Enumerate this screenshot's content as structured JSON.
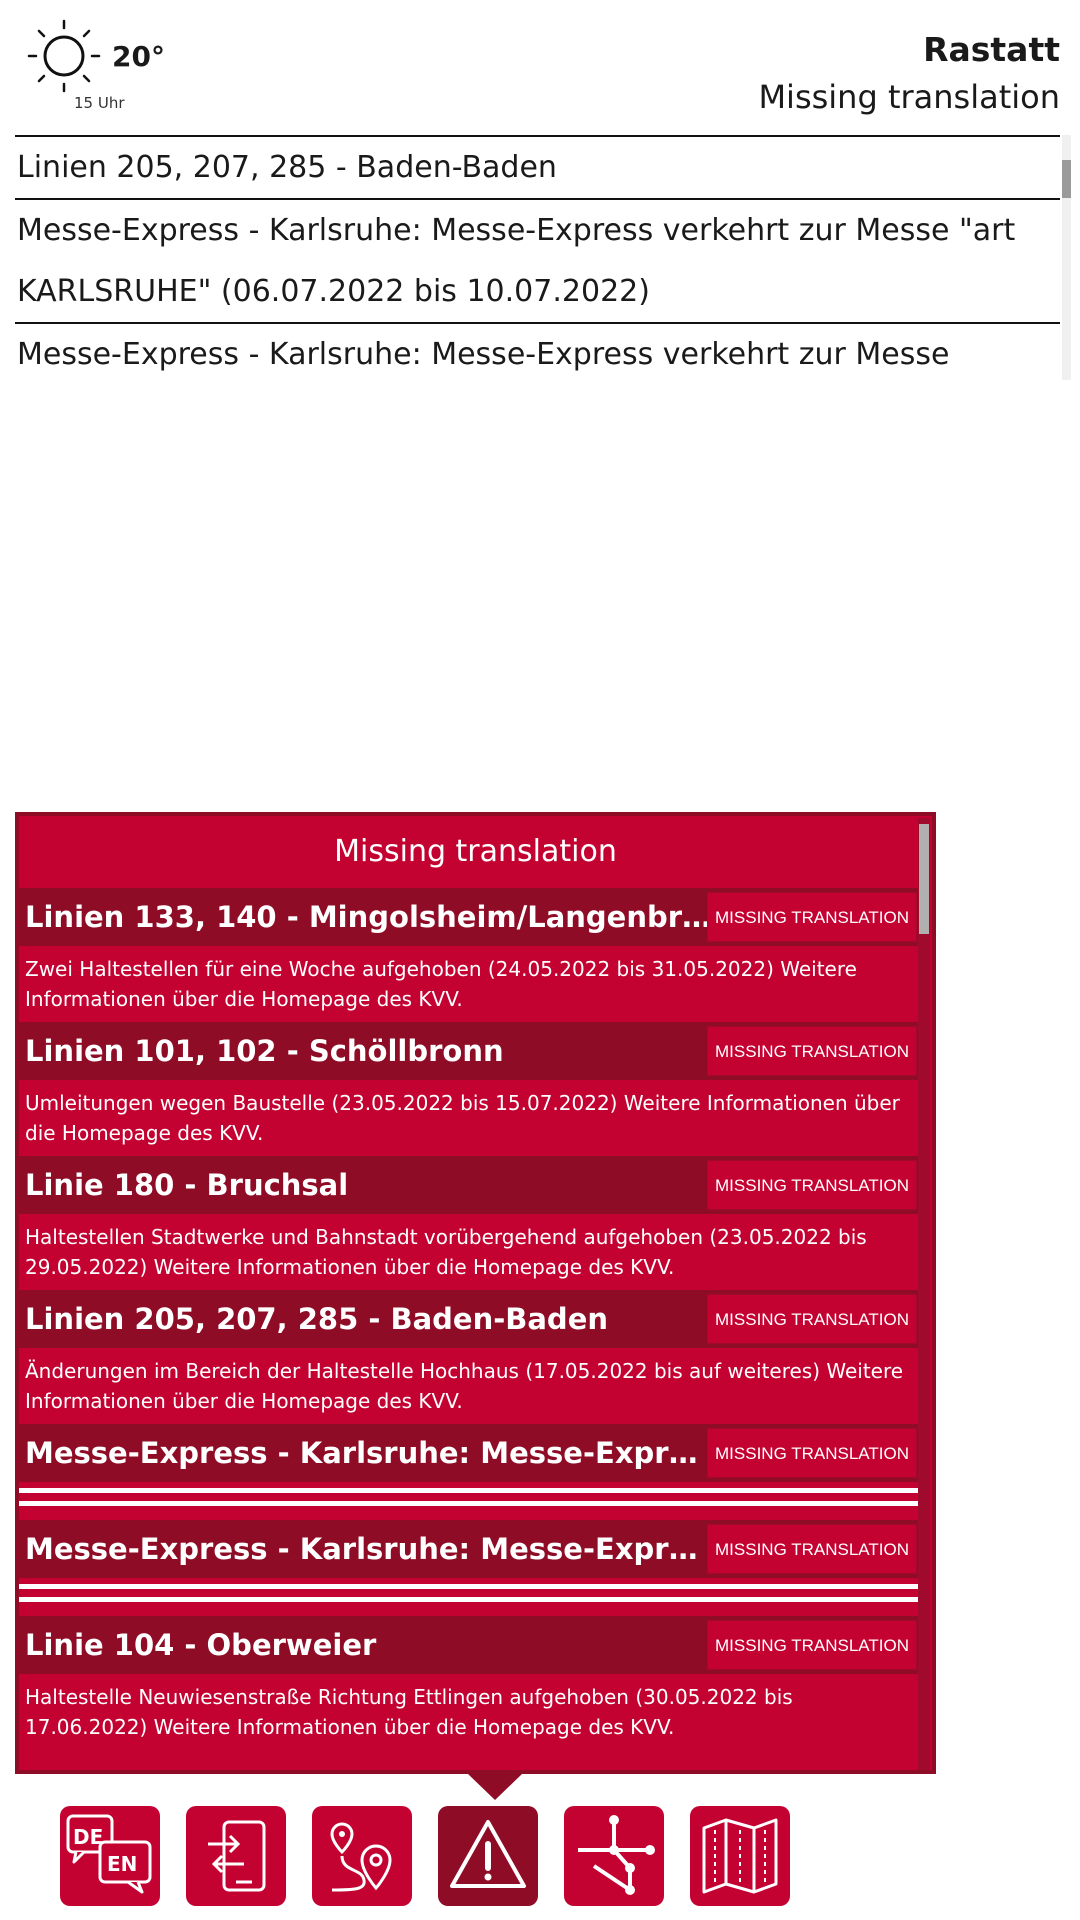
{
  "header": {
    "temperature": "20°",
    "hour": "15 Uhr",
    "city": "Rastatt",
    "subtitle": "Missing translation",
    "weather_icon": "sun-icon"
  },
  "ticker": {
    "rows": [
      "Linien 205, 207, 285 - Baden-Baden",
      "Messe-Express - Karlsruhe: Messe-Express verkehrt zur Messe \"art",
      "KARLSRUHE\" (06.07.2022 bis 10.07.2022)",
      "Messe-Express - Karlsruhe: Messe-Express verkehrt zur Messe"
    ]
  },
  "panel": {
    "title": "Missing translation",
    "alerts": [
      {
        "title": "Linien 133, 140 - Mingolsheim/Langenbrücken",
        "button": "MISSING TRANSLATION",
        "body": "Zwei Haltestellen für eine Woche aufgehoben (24.05.2022 bis 31.05.2022) Weitere Informationen über die Homepage des KVV."
      },
      {
        "title": "Linien 101, 102 - Schöllbronn",
        "button": "MISSING TRANSLATION",
        "body": "Umleitungen wegen Baustelle (23.05.2022 bis 15.07.2022) Weitere Informationen über die Homepage des KVV."
      },
      {
        "title": "Linie 180 - Bruchsal",
        "button": "MISSING TRANSLATION",
        "body": "Haltestellen Stadtwerke und Bahnstadt vorübergehend aufgehoben (23.05.2022 bis 29.05.2022) Weitere Informationen über die Homepage des KVV."
      },
      {
        "title": "Linien 205, 207, 285 - Baden-Baden",
        "button": "MISSING TRANSLATION",
        "body": "Änderungen im Bereich der Haltestelle Hochhaus (17.05.2022 bis auf weiteres) Weitere Informationen über die Homepage des KVV."
      },
      {
        "title": "Messe-Express - Karlsruhe: Messe-Express",
        "button": "MISSING TRANSLATION",
        "body": ""
      },
      {
        "title": "Messe-Express - Karlsruhe: Messe-Express",
        "button": "MISSING TRANSLATION",
        "body": ""
      },
      {
        "title": "Linie 104 - Oberweier",
        "button": "MISSING TRANSLATION",
        "body": "Haltestelle Neuwiesenstraße Richtung Ettlingen aufgehoben (30.05.2022 bis 17.06.2022) Weitere Informationen über die Homepage des KVV."
      }
    ]
  },
  "navbar": {
    "items": [
      {
        "icon": "language-de-en-icon",
        "label_de": "DE",
        "label_en": "EN"
      },
      {
        "icon": "departures-icon"
      },
      {
        "icon": "route-pin-icon"
      },
      {
        "icon": "warning-icon",
        "active": true
      },
      {
        "icon": "network-map-icon"
      },
      {
        "icon": "city-map-icon"
      }
    ]
  },
  "colors": {
    "primary": "#c40232",
    "dark": "#8e0c26"
  }
}
